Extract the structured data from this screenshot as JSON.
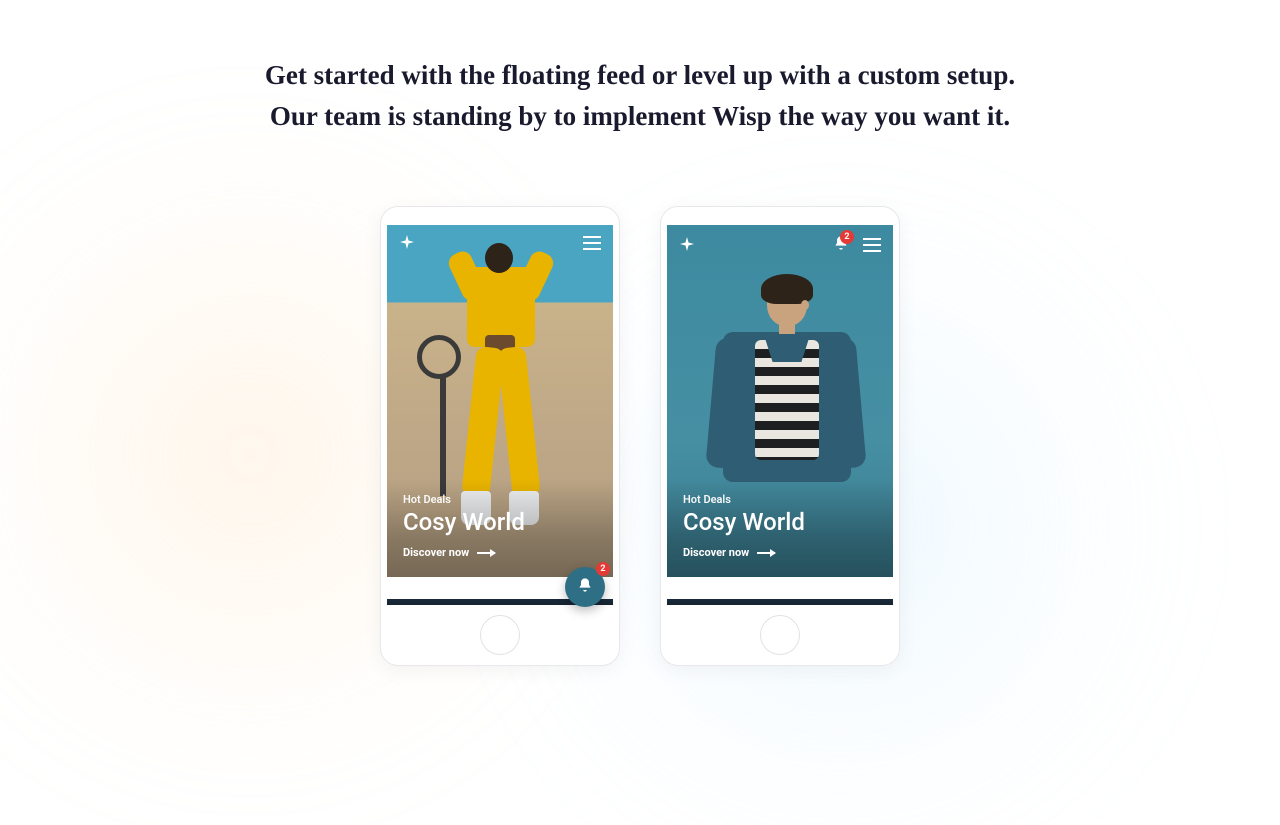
{
  "heading_line1": "Get started with the floating feed or level up with a custom setup.",
  "heading_line2": "Our team is standing by to implement Wisp the way you want it.",
  "phones": [
    {
      "eyebrow": "Hot Deals",
      "title": "Cosy World",
      "cta": "Discover now",
      "badge": "2",
      "bell_position": "fab"
    },
    {
      "eyebrow": "Hot Deals",
      "title": "Cosy World",
      "cta": "Discover now",
      "badge": "2",
      "bell_position": "topbar"
    }
  ],
  "icons": {
    "sparkle": "sparkle-icon",
    "hamburger": "hamburger-icon",
    "bell": "bell-icon"
  }
}
